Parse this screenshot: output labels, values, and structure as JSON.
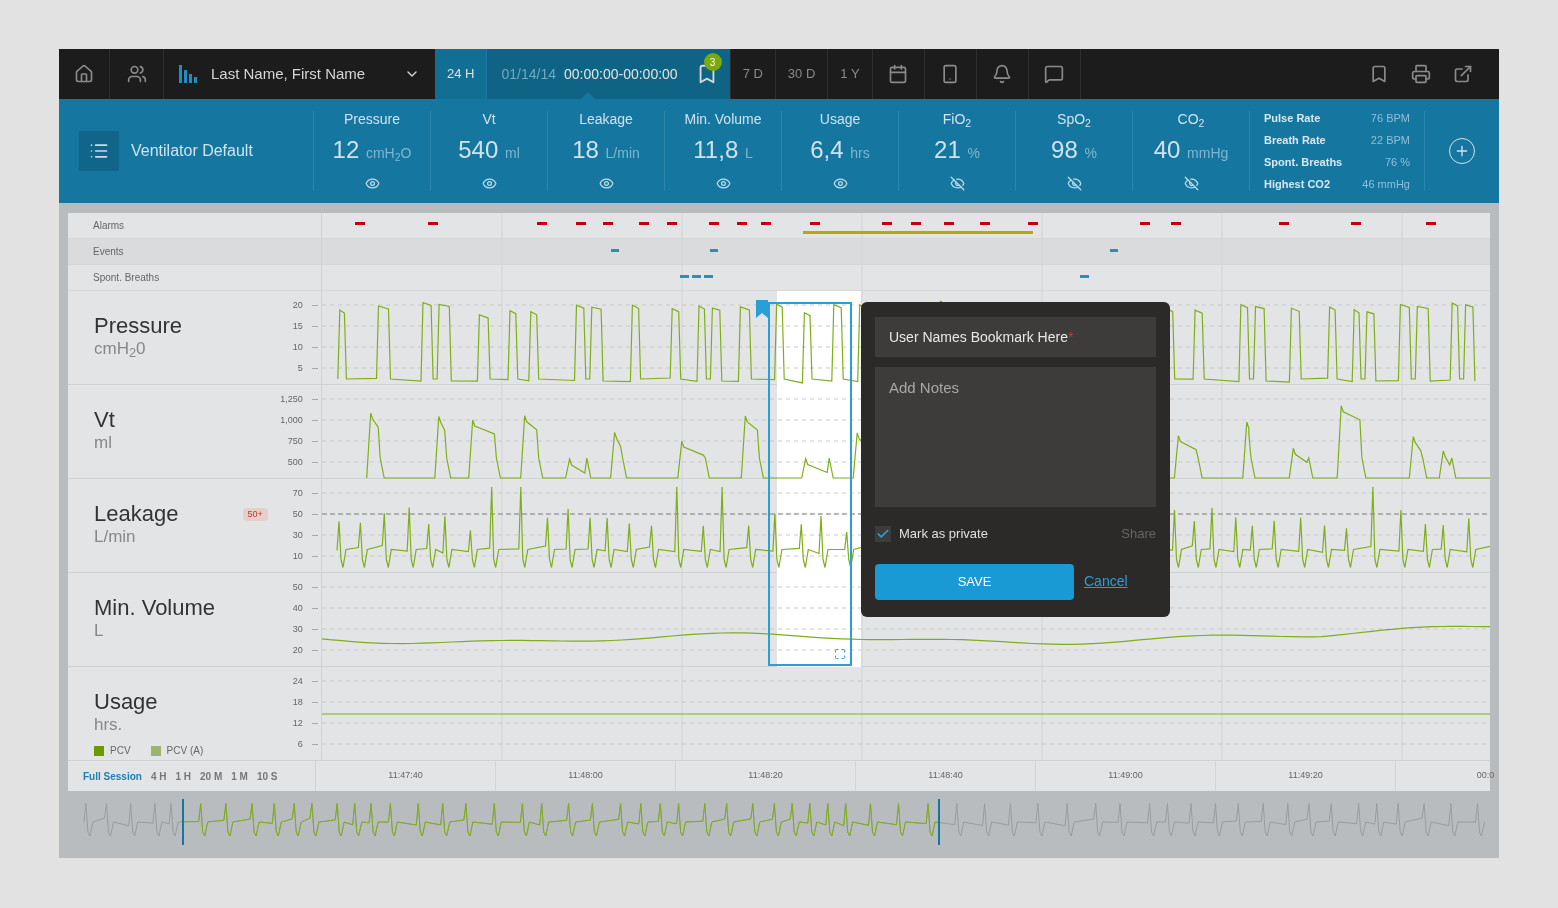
{
  "nav": {
    "patient_name": "Last Name, First Name",
    "ranges": [
      {
        "label": "24 H",
        "selected": true
      },
      {
        "label": "7 D",
        "selected": false
      },
      {
        "label": "30 D",
        "selected": false
      },
      {
        "label": "1 Y",
        "selected": false
      }
    ],
    "date": "01/14/14",
    "time": "00:00:00-00:00:00",
    "bookmark_count": "3"
  },
  "profile": {
    "name": "Ventilator Default"
  },
  "metrics": [
    {
      "label": "Pressure",
      "value": "12",
      "unit": "cmH$_{2}$O",
      "visible": true
    },
    {
      "label": "Vt",
      "value": "540",
      "unit": "ml",
      "visible": true
    },
    {
      "label": "Leakage",
      "value": "18",
      "unit": "L/min",
      "visible": true
    },
    {
      "label": "Min. Volume",
      "value": "11,8",
      "unit": "L",
      "visible": true
    },
    {
      "label": "Usage",
      "value": "6,4",
      "unit": "hrs",
      "visible": true
    },
    {
      "label": "FiO$_{2}$",
      "value": "21",
      "unit": "%",
      "visible": false
    },
    {
      "label": "SpO$_{2}$",
      "value": "98",
      "unit": "%",
      "visible": false
    },
    {
      "label": "CO$_{2}$",
      "value": "40",
      "unit": "mmHg",
      "visible": false
    }
  ],
  "vitals": [
    {
      "label": "Pulse Rate",
      "value": "76 BPM"
    },
    {
      "label": "Breath Rate",
      "value": "22 BPM"
    },
    {
      "label": "Spont. Breaths",
      "value": "76 %"
    },
    {
      "label": "Highest CO2",
      "value": "46 mmHg"
    }
  ],
  "lanes": [
    {
      "label": "Alarms"
    },
    {
      "label": "Events"
    },
    {
      "label": "Spont. Breaths"
    }
  ],
  "charts": [
    {
      "title": "Pressure",
      "unit": "cmH$_{2}$0",
      "kind": "square",
      "ticks": [
        "20",
        "15",
        "10",
        "5"
      ]
    },
    {
      "title": "Vt",
      "unit": "ml",
      "kind": "peak",
      "ticks": [
        "1,250",
        "1,000",
        "750",
        "500"
      ]
    },
    {
      "title": "Leakage",
      "unit": "L/min",
      "kind": "spiky",
      "ticks": [
        "70",
        "50",
        "30",
        "10"
      ],
      "threshold": "50+"
    },
    {
      "title": "Min. Volume",
      "unit": "L",
      "kind": "trend",
      "ticks": [
        "50",
        "40",
        "30",
        "20"
      ]
    },
    {
      "title": "Usage",
      "unit": "hrs.",
      "kind": "flat",
      "ticks": [
        "24",
        "18",
        "12",
        "6"
      ],
      "legend": [
        {
          "label": "PCV",
          "color": "#6a9a00"
        },
        {
          "label": "PCV (A)",
          "color": "#9db56a"
        }
      ]
    }
  ],
  "zoom_levels": [
    {
      "label": "Full Session",
      "selected": true
    },
    {
      "label": "4 H",
      "selected": false
    },
    {
      "label": "1 H",
      "selected": false
    },
    {
      "label": "20 M",
      "selected": false
    },
    {
      "label": "1 M",
      "selected": false
    },
    {
      "label": "10 S",
      "selected": false
    }
  ],
  "time_ticks": [
    "11:47:40",
    "11:48:00",
    "11:48:20",
    "11:48:40",
    "11:49:00",
    "11:49:20",
    "00:0"
  ],
  "bookmark_popup": {
    "title": "User Names Bookmark Here",
    "required_mark": "*",
    "notes_placeholder": "Add Notes",
    "private": {
      "label": "Mark as private",
      "checked": true
    },
    "share": {
      "label": "Share",
      "disabled": true
    },
    "save": "SAVE",
    "cancel": "Cancel"
  }
}
